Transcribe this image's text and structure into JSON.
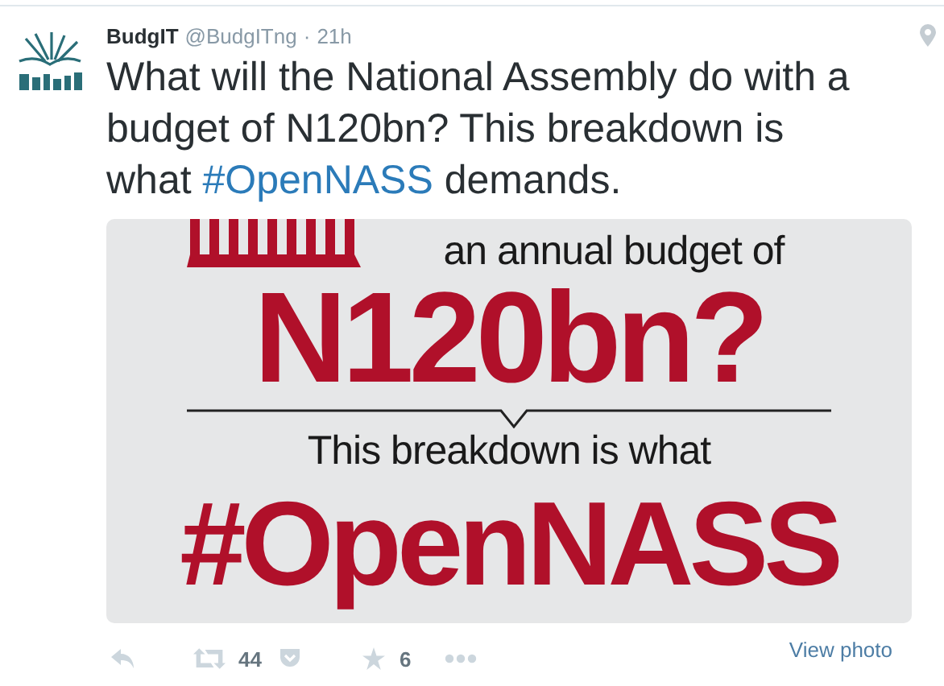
{
  "tweet": {
    "author": "BudgIT",
    "handle": "@BudgITng",
    "separator": "·",
    "time": "21h",
    "text": [
      {
        "kind": "text",
        "value": "What will the National Assembly do with a budget of N120bn? This breakdown is what "
      },
      {
        "kind": "hashtag",
        "value": "#OpenNASS"
      },
      {
        "kind": "text",
        "value": " demands."
      }
    ]
  },
  "photo": {
    "lines": [
      {
        "kind": "small",
        "value": "an annual budget of"
      },
      {
        "kind": "big",
        "value": "N120bn?"
      },
      {
        "kind": "small",
        "value": "This breakdown is what"
      },
      {
        "kind": "big",
        "value": "#OpenNASS"
      }
    ]
  },
  "actions": [
    {
      "kind": "reply"
    },
    {
      "kind": "retweet",
      "count": "44"
    },
    {
      "kind": "pocket"
    },
    {
      "kind": "favorite",
      "count": "6"
    },
    {
      "kind": "more"
    }
  ],
  "view_photo": "View photo"
}
